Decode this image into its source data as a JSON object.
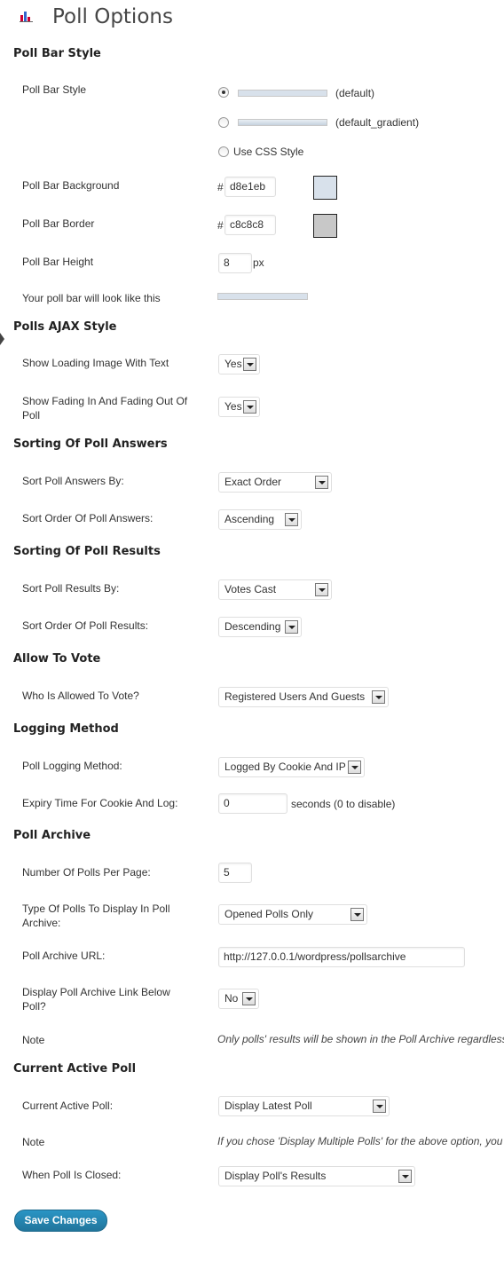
{
  "title": "Poll Options",
  "colors": {
    "bar_background": "#d8e1eb",
    "bar_border": "#c8c8c8",
    "button": "#21759b"
  },
  "bar_style": {
    "heading": "Poll Bar Style",
    "label": "Poll Bar Style",
    "options": [
      "(default)",
      "(default_gradient)",
      "Use CSS Style"
    ],
    "selected": "(default)",
    "background_label": "Poll Bar Background",
    "background_value": "d8e1eb",
    "border_label": "Poll Bar Border",
    "border_value": "c8c8c8",
    "height_label": "Poll Bar Height",
    "height_value": "8",
    "height_unit": "px",
    "preview_label": "Your poll bar will look like this",
    "hash": "#"
  },
  "ajax": {
    "heading": "Polls AJAX Style",
    "loading_label": "Show Loading Image With Text",
    "loading_value": "Yes",
    "fading_label": "Show Fading In And Fading Out Of Poll",
    "fading_value": "Yes"
  },
  "sort_answers": {
    "heading": "Sorting Of Poll Answers",
    "by_label": "Sort Poll Answers By:",
    "by_value": "Exact Order",
    "order_label": "Sort Order Of Poll Answers:",
    "order_value": "Ascending"
  },
  "sort_results": {
    "heading": "Sorting Of Poll Results",
    "by_label": "Sort Poll Results By:",
    "by_value": "Votes Cast",
    "order_label": "Sort Order Of Poll Results:",
    "order_value": "Descending"
  },
  "allow_vote": {
    "heading": "Allow To Vote",
    "who_label": "Who Is Allowed To Vote?",
    "who_value": "Registered Users And Guests"
  },
  "logging": {
    "heading": "Logging Method",
    "method_label": "Poll Logging Method:",
    "method_value": "Logged By Cookie And IP",
    "expiry_label": "Expiry Time For Cookie And Log:",
    "expiry_value": "0",
    "expiry_hint": "seconds (0 to disable)"
  },
  "archive": {
    "heading": "Poll Archive",
    "per_page_label": "Number Of Polls Per Page:",
    "per_page_value": "5",
    "type_label": "Type Of Polls To Display In Poll Archive:",
    "type_value": "Opened Polls Only",
    "url_label": "Poll Archive URL:",
    "url_value": "http://127.0.0.1/wordpress/pollsarchive",
    "link_label": "Display Poll Archive Link Below Poll?",
    "link_value": "No",
    "note_label": "Note",
    "note_text": "Only polls' results will be shown in the Poll Archive regardless"
  },
  "current": {
    "heading": "Current Active Poll",
    "active_label": "Current Active Poll:",
    "active_value": "Display Latest Poll",
    "note_label": "Note",
    "note_text": "If you chose 'Display Multiple Polls' for the above option, you",
    "closed_label": "When Poll Is Closed:",
    "closed_value": "Display Poll's Results"
  },
  "save_label": "Save Changes"
}
